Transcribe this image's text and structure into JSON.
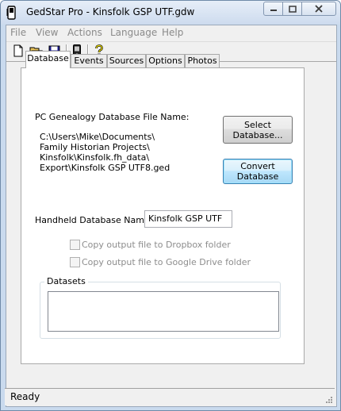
{
  "window": {
    "title": "GedStar Pro - Kinsfolk GSP UTF.gdw"
  },
  "menu": {
    "items": [
      "File",
      "View",
      "Actions",
      "Language",
      "Help"
    ]
  },
  "toolbar": {
    "buttons": [
      "new-file-icon",
      "open-folder-icon",
      "save-icon",
      "handheld-device-icon",
      "help-icon"
    ]
  },
  "tabs": [
    {
      "label": "Database",
      "active": true
    },
    {
      "label": "Events"
    },
    {
      "label": "Sources"
    },
    {
      "label": "Options"
    },
    {
      "label": "Photos"
    }
  ],
  "database_tab": {
    "pc_file_label": "PC Genealogy Database File Name:",
    "pc_file_path_lines": [
      "C:\\Users\\Mike\\Documents\\",
      "Family Historian Projects\\",
      "Kinsfolk\\Kinsfolk.fh_data\\",
      "Export\\Kinsfolk GSP UTF8.ged"
    ],
    "select_button_lines": [
      "Select",
      "Database..."
    ],
    "convert_button_lines": [
      "Convert",
      "Database"
    ],
    "handheld_label": "Handheld Database Name:",
    "handheld_value": "Kinsfolk GSP UTF",
    "dropbox_checkbox": {
      "label": "Copy output file to Dropbox folder",
      "checked": false,
      "enabled": false
    },
    "gdrive_checkbox": {
      "label": "Copy output file to Google Drive folder",
      "checked": false,
      "enabled": false
    },
    "datasets_label": "Datasets"
  },
  "status": {
    "text": "Ready"
  },
  "colors": {
    "focus_border": "#3c7fb1",
    "title_bar": "#cddbee",
    "disabled_text": "#8d8d8d"
  }
}
